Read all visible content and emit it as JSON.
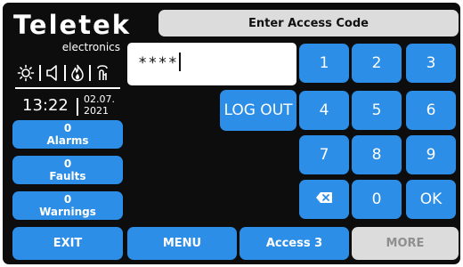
{
  "brand": {
    "name": "Teletek",
    "sub": "electronics"
  },
  "status_icons": [
    "sun-icon",
    "speaker-icon",
    "fire-icon",
    "tap-icon"
  ],
  "datetime": {
    "time": "13:22",
    "date_line1": "02.07.",
    "date_line2": "2021"
  },
  "counters": [
    {
      "value": "0",
      "label": "Alarms"
    },
    {
      "value": "0",
      "label": "Faults"
    },
    {
      "value": "0",
      "label": "Warnings"
    }
  ],
  "header": {
    "title": "Enter Access Code"
  },
  "code_input": {
    "value": "****"
  },
  "logout": {
    "label": "LOG OUT"
  },
  "keypad": {
    "k1": "1",
    "k2": "2",
    "k3": "3",
    "k4": "4",
    "k5": "5",
    "k6": "6",
    "k7": "7",
    "k8": "8",
    "k9": "9",
    "k0": "0",
    "ok": "OK",
    "backspace_icon": "backspace-icon"
  },
  "bottom_bar": {
    "exit": "EXIT",
    "menu": "MENU",
    "access": "Access 3",
    "more": "MORE"
  },
  "colors": {
    "background": "#0d0d0d",
    "button": "#2c8ee6",
    "title_bar": "#dcdcdc",
    "disabled_text": "#8f8f8f",
    "text": "#ffffff"
  }
}
